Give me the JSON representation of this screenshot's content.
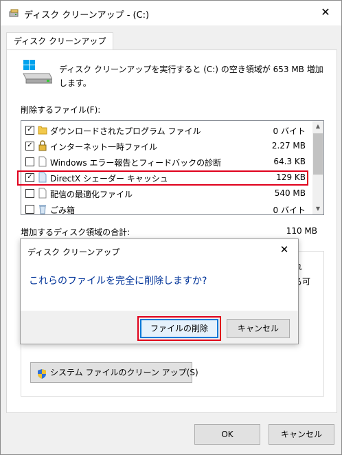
{
  "window": {
    "title": "ディスク クリーンアップ - (C:)",
    "close_glyph": "✕"
  },
  "tab": {
    "label": "ディスク クリーンアップ"
  },
  "summary": {
    "line1": "ディスク クリーンアップを実行すると (C:) の空き領域が 653 MB 増加",
    "line2": "します。"
  },
  "files_label": "削除するファイル(F):",
  "files": [
    {
      "checked": true,
      "icon": "folder-icon",
      "name": "ダウンロードされたプログラム ファイル",
      "size": "0 バイト"
    },
    {
      "checked": true,
      "icon": "lock-icon",
      "name": "インターネット一時ファイル",
      "size": "2.27 MB"
    },
    {
      "checked": false,
      "icon": "file-icon",
      "name": "Windows エラー報告とフィードバックの診断",
      "size": "64.3 KB"
    },
    {
      "checked": true,
      "icon": "file-icon",
      "name": "DirectX シェーダー キャッシュ",
      "size": "129 KB"
    },
    {
      "checked": false,
      "icon": "file-icon",
      "name": "配信の最適化ファイル",
      "size": "540 MB"
    },
    {
      "checked": false,
      "icon": "recycle-bin-icon",
      "name": "ごみ箱",
      "size": "0 バイト"
    }
  ],
  "total": {
    "label": "増加するディスク領域の合計:",
    "value": "110 MB"
  },
  "background_fragments": {
    "frag1": "れ",
    "frag2": "る可"
  },
  "system_cleanup_button": "システム ファイルのクリーン アップ(S)",
  "ok_button": "OK",
  "cancel_button": "キャンセル",
  "dialog": {
    "title": "ディスク クリーンアップ",
    "message": "これらのファイルを完全に削除しますか?",
    "delete_button": "ファイルの削除",
    "cancel_button": "キャンセル",
    "close_glyph": "✕"
  }
}
